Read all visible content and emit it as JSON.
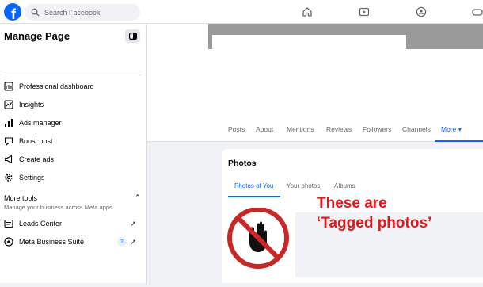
{
  "header": {
    "logo_letter": "f",
    "search_placeholder": "Search Facebook"
  },
  "sidebar": {
    "title": "Manage Page",
    "items": [
      {
        "label": "Professional dashboard",
        "icon": "dashboard-icon"
      },
      {
        "label": "Insights",
        "icon": "insights-icon"
      },
      {
        "label": "Ads manager",
        "icon": "chart-icon"
      },
      {
        "label": "Boost post",
        "icon": "boost-icon"
      },
      {
        "label": "Create ads",
        "icon": "megaphone-icon"
      },
      {
        "label": "Settings",
        "icon": "gear-icon"
      }
    ],
    "more_tools": {
      "title": "More tools",
      "subtitle": "Manage your business across Meta apps",
      "items": [
        {
          "label": "Leads Center",
          "icon": "leads-icon"
        },
        {
          "label": "Meta Business Suite",
          "icon": "meta-icon",
          "badge": "2"
        }
      ]
    }
  },
  "profile_tabs": [
    "Posts",
    "About",
    "Mentions",
    "Reviews",
    "Followers",
    "Channels",
    "More ▾"
  ],
  "photos": {
    "title": "Photos",
    "tabs": [
      "Photos of You",
      "Your photos",
      "Albums"
    ]
  },
  "annotation": {
    "line1": "These are",
    "line2": "‘Tagged photos’",
    "color": "#e8141b"
  },
  "colors": {
    "accent": "#0866ff",
    "brand": "#0866ff"
  }
}
